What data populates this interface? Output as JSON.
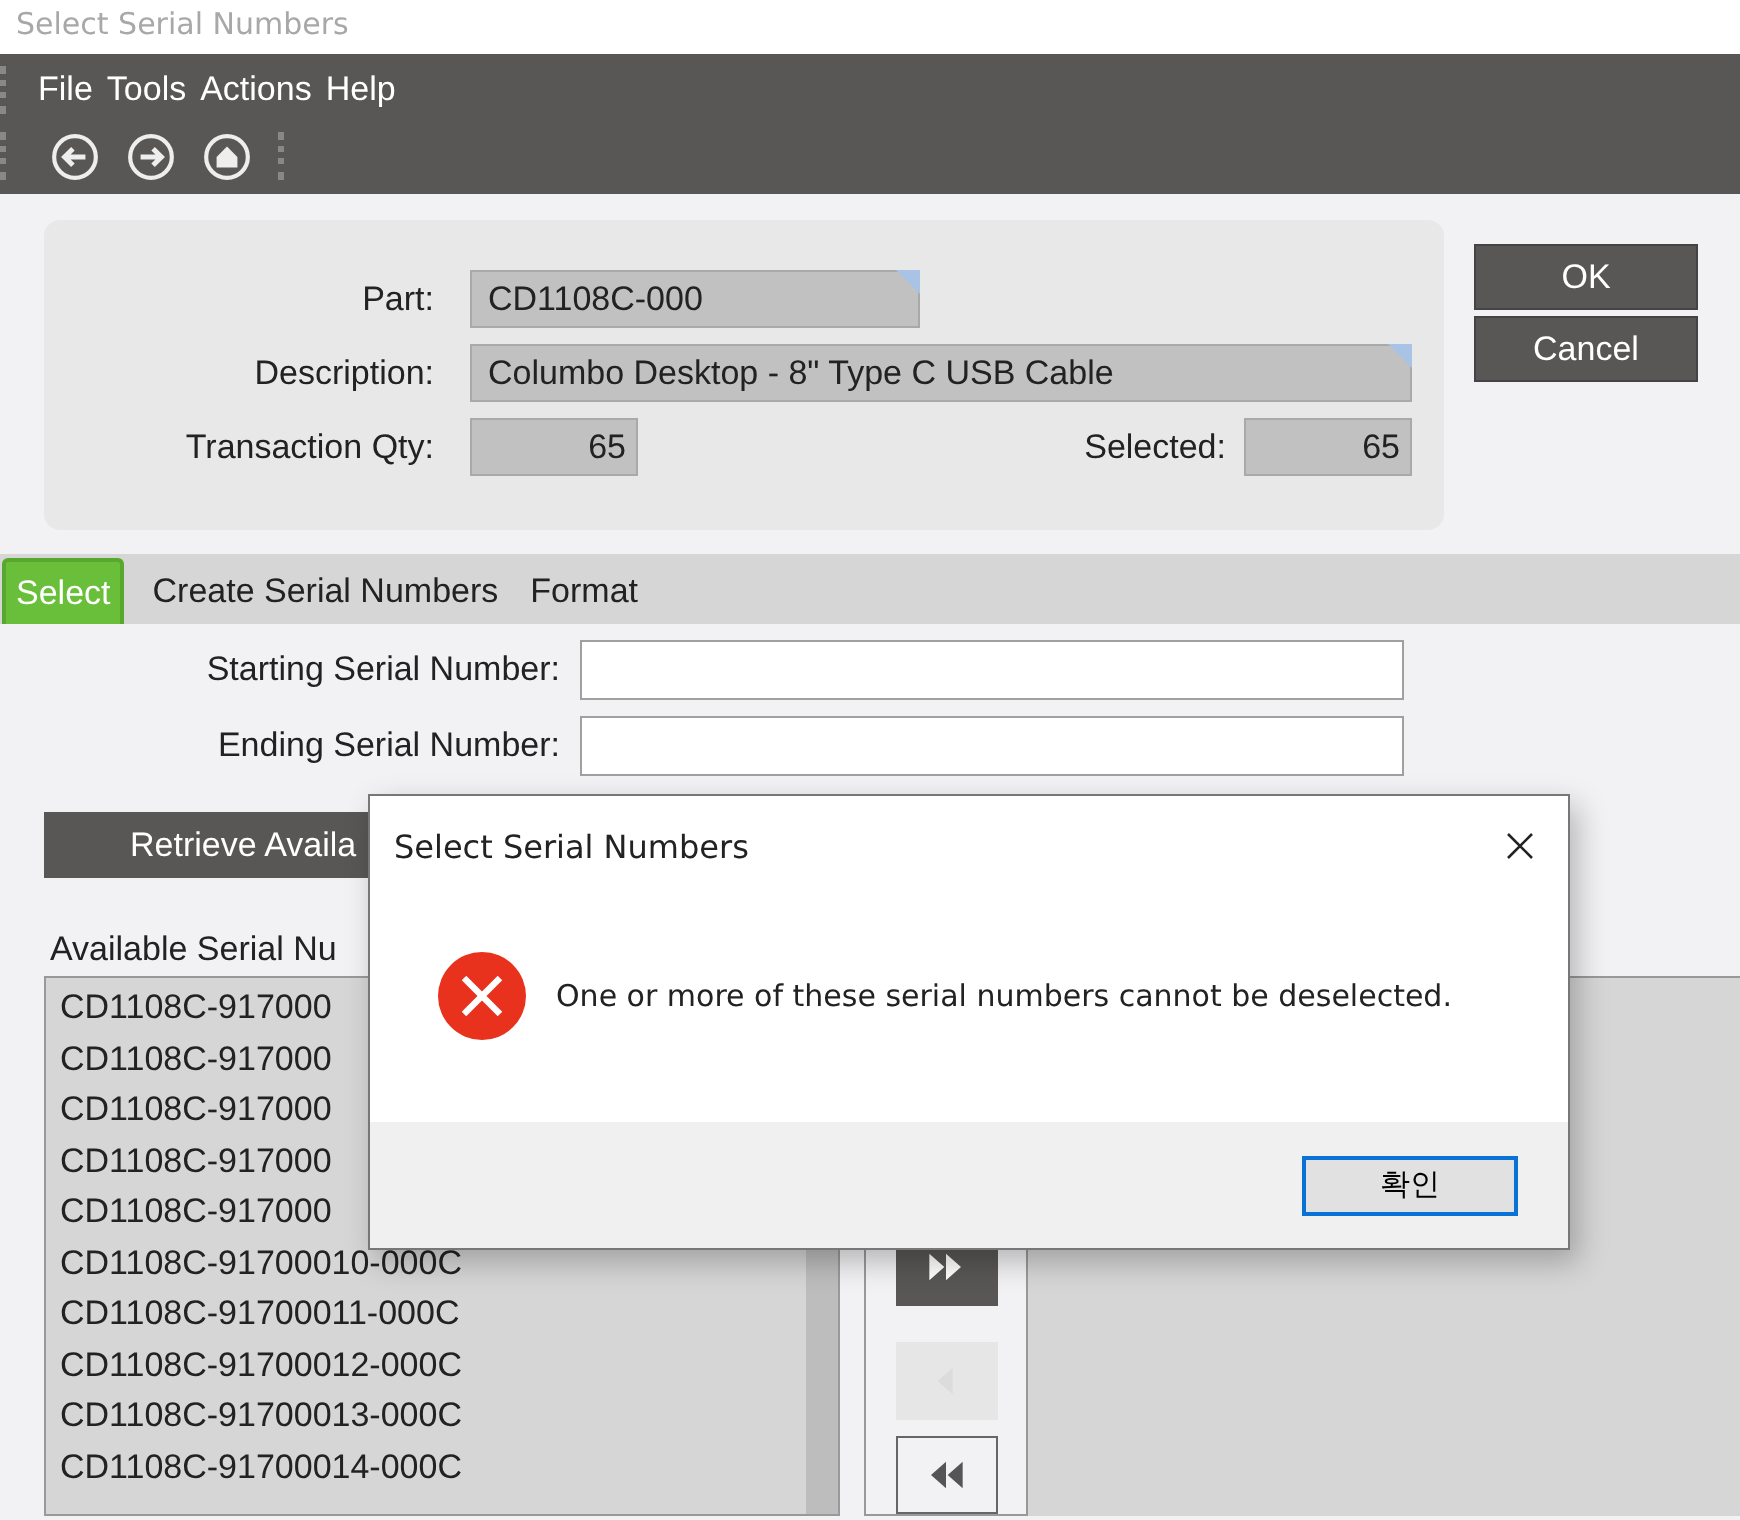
{
  "window": {
    "title": "Select Serial Numbers"
  },
  "menu": [
    "File",
    "Tools",
    "Actions",
    "Help"
  ],
  "header": {
    "part_label": "Part:",
    "part": "CD1108C-000",
    "description_label": "Description:",
    "description": "Columbo Desktop - 8\" Type C USB Cable",
    "qty_label": "Transaction Qty:",
    "qty": "65",
    "selected_label": "Selected:",
    "selected_count": "65"
  },
  "buttons": [
    "OK",
    "Cancel"
  ],
  "tabs": [
    {
      "label": "Select",
      "selected": true
    },
    {
      "label": "Create Serial Numbers",
      "selected": false
    },
    {
      "label": "Format",
      "selected": false
    }
  ],
  "filters": [
    {
      "label": "Starting Serial Number:"
    },
    {
      "label": "Ending Serial Number:"
    }
  ],
  "retrieve_button": "Retrieve Availa",
  "available": {
    "label": "Available Serial Nu",
    "rows": [
      "CD1108C-917000",
      "CD1108C-917000",
      "CD1108C-917000",
      "CD1108C-917000",
      "CD1108C-917000",
      "CD1108C-91700010-000C",
      "CD1108C-91700011-000C",
      "CD1108C-91700012-000C",
      "CD1108C-91700013-000C",
      "CD1108C-91700014-000C"
    ]
  },
  "transfer_buttons": [
    {
      "kind": "move-all-right",
      "disabled": false
    },
    {
      "kind": "move-left",
      "disabled": true
    },
    {
      "kind": "move-all-left",
      "disabled": false
    }
  ],
  "dialog": {
    "title": "Select Serial Numbers",
    "message": "One or more of these serial numbers cannot be deselected.",
    "button": "확인"
  }
}
